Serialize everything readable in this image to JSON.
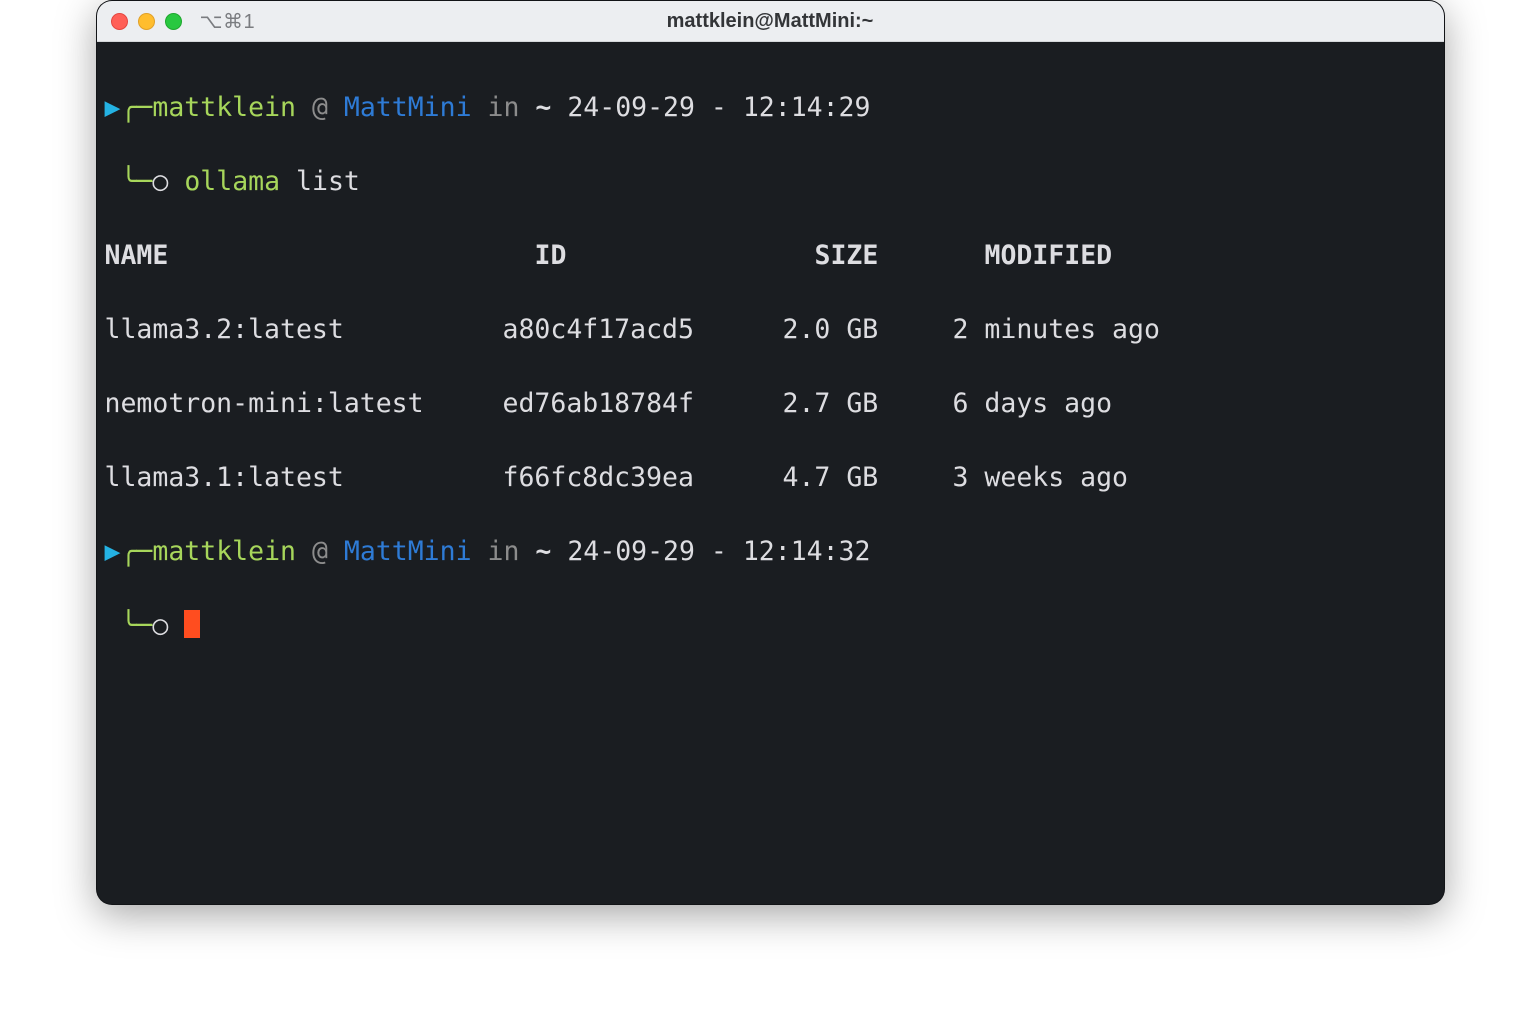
{
  "window": {
    "title": "mattklein@MattMini:~",
    "shortcut_indicator": "⌥⌘1"
  },
  "prompt1": {
    "user": "mattklein",
    "at": "@",
    "host": "MattMini",
    "in": "in",
    "dir": "~",
    "time": "24-09-29 - 12:14:29",
    "command": "ollama",
    "args": "list"
  },
  "table": {
    "headers": {
      "name": "NAME",
      "id": "ID",
      "size": "SIZE",
      "modified": "MODIFIED"
    },
    "rows": [
      {
        "name": "llama3.2:latest",
        "id": "a80c4f17acd5",
        "size": "2.0 GB",
        "modified": "2 minutes ago"
      },
      {
        "name": "nemotron-mini:latest",
        "id": "ed76ab18784f",
        "size": "2.7 GB",
        "modified": "6 days ago"
      },
      {
        "name": "llama3.1:latest",
        "id": "f66fc8dc39ea",
        "size": "4.7 GB",
        "modified": "3 weeks ago"
      }
    ]
  },
  "prompt2": {
    "user": "mattklein",
    "at": "@",
    "host": "MattMini",
    "in": "in",
    "dir": "~",
    "time": "24-09-29 - 12:14:32"
  },
  "glyphs": {
    "arrow": "▸",
    "top_corner": "╭─",
    "bot_corner": "╰─",
    "knot": "○"
  }
}
